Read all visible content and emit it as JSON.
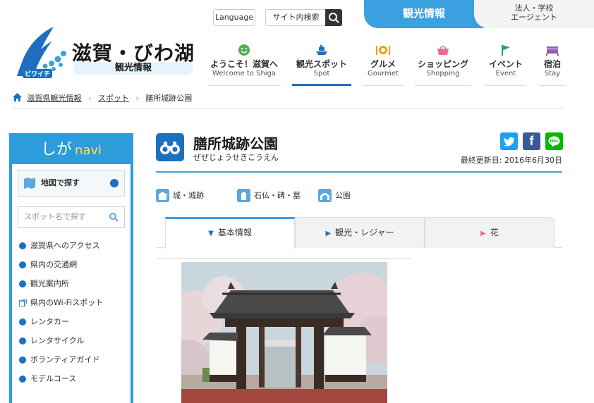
{
  "header": {
    "logo_title": "滋賀・びわ湖",
    "logo_sub": "観光情報",
    "logo_mascot": "ビワイチ",
    "lang_label": "Language",
    "search_label": "サイト内検索",
    "tab_kanko": "観光情報",
    "tab_agent_line1": "法人・学校",
    "tab_agent_line2": "エージェント"
  },
  "gnav": [
    {
      "jp": "ようこそ！滋賀へ",
      "en": "Welcome to Shiga",
      "icon": "smile-icon"
    },
    {
      "jp": "観光スポット",
      "en": "Spot",
      "icon": "boat-icon"
    },
    {
      "jp": "グルメ",
      "en": "Gourmet",
      "icon": "gourmet-icon"
    },
    {
      "jp": "ショッピング",
      "en": "Shopping",
      "icon": "basket-icon"
    },
    {
      "jp": "イベント",
      "en": "Event",
      "icon": "flag-icon"
    },
    {
      "jp": "宿泊",
      "en": "Stay",
      "icon": "bed-icon"
    }
  ],
  "breadcrumb": [
    "滋賀県観光情報",
    "スポット",
    "膳所城跡公園"
  ],
  "sidebar": {
    "head_jp": "しが",
    "head_navi": "navi",
    "map_btn": "地図で探す",
    "search_placeholder": "スポット名で探す",
    "items": [
      "滋賀県へのアクセス",
      "県内の交通網",
      "観光案内所",
      "県内のWi-Fiスポット",
      "レンタカー",
      "レンタサイクル",
      "ボランティアガイド",
      "モデルコース"
    ]
  },
  "main": {
    "title": "膳所城跡公園",
    "ruby": "ぜぜじょうせきこうえん",
    "updated": "最終更新日: 2016年6月30日",
    "categories": [
      "城・城跡",
      "石仏・碑・墓",
      "公園"
    ],
    "tabs": [
      "基本情報",
      "観光・レジャー",
      "花"
    ]
  },
  "colors": {
    "accent": "#3aa0e0",
    "brand": "#1e6fc0",
    "twitter": "#1da1f2",
    "facebook": "#3b5998",
    "line": "#00b900"
  }
}
